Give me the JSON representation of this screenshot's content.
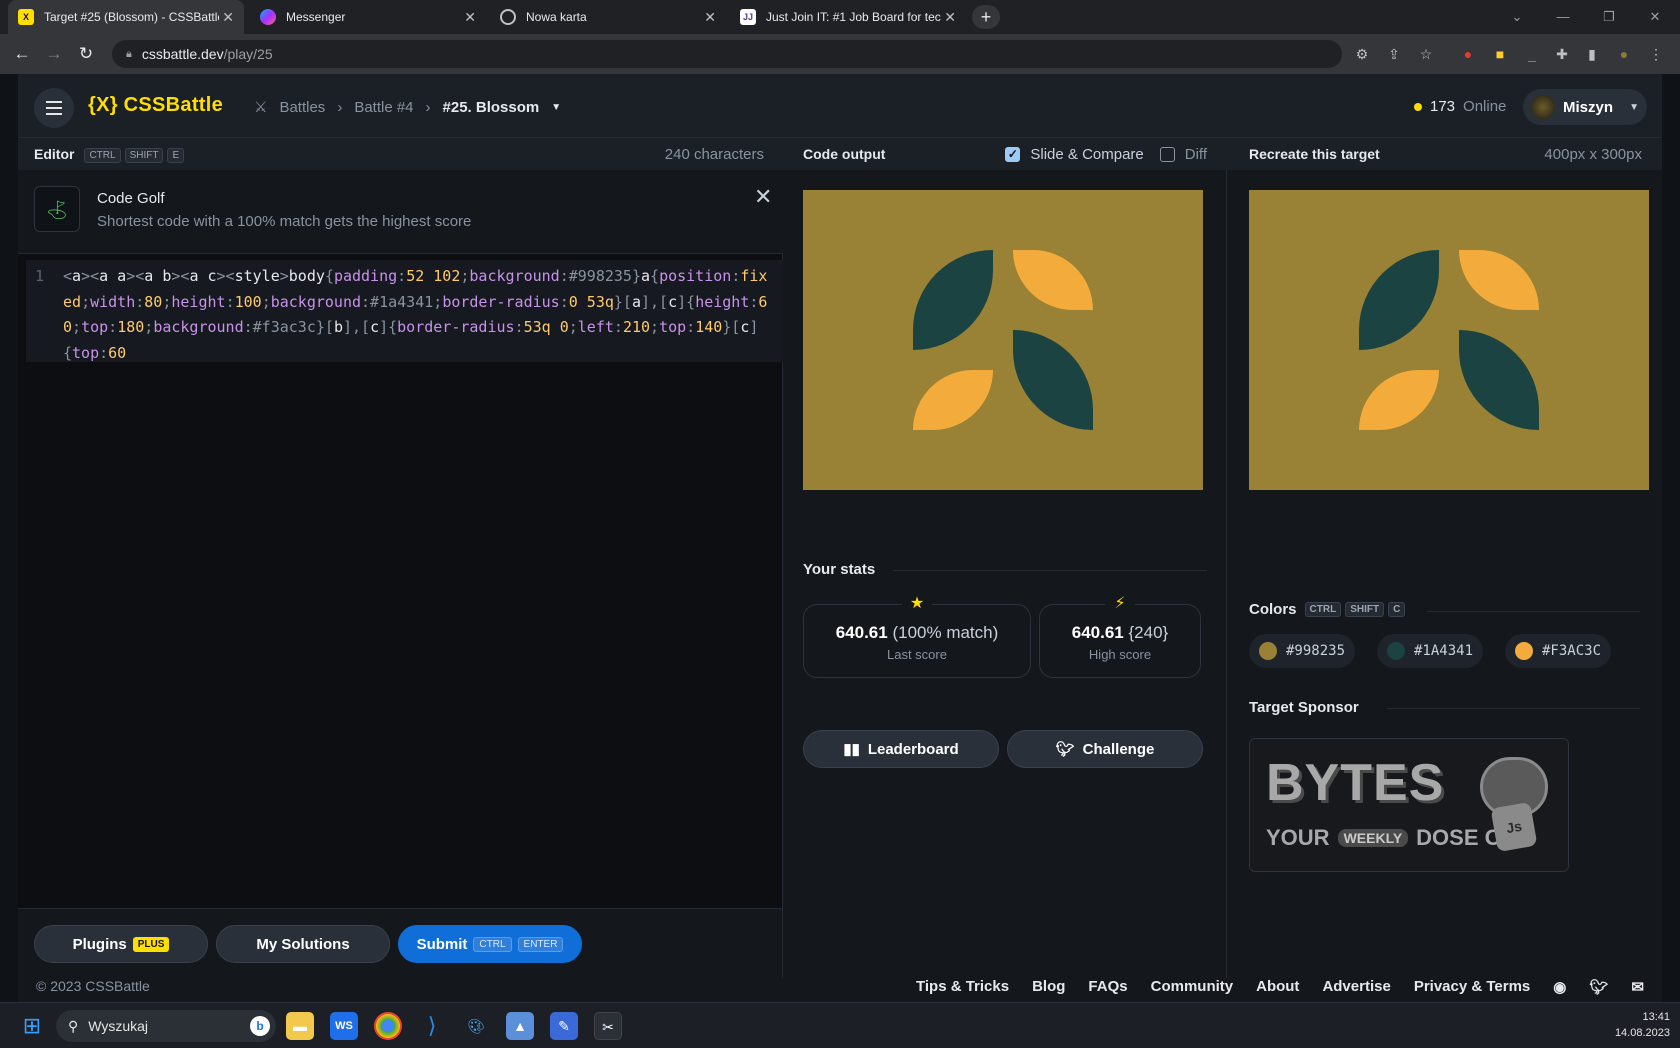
{
  "browser": {
    "tabs": [
      {
        "title": "Target #25 (Blossom) - CSSBattle",
        "icon": "cssbattle-favicon",
        "active": true
      },
      {
        "title": "Messenger",
        "icon": "messenger-favicon",
        "active": false
      },
      {
        "title": "Nowa karta",
        "icon": "chrome-favicon",
        "active": false
      },
      {
        "title": "Just Join IT: #1 Job Board for tec",
        "icon": "justjoinit-favicon",
        "active": false
      }
    ],
    "url_host": "cssbattle.dev",
    "url_path": "/play/25"
  },
  "header": {
    "logo": "{X} CSSBattle",
    "breadcrumbs": [
      "Battles",
      "Battle #4",
      "#25. Blossom"
    ],
    "online_count": "173",
    "online_label": "Online",
    "user": "Miszyn"
  },
  "editor": {
    "title": "Editor",
    "shortcut": [
      "CTRL",
      "SHIFT",
      "E"
    ],
    "chars": "240 characters",
    "golf_title": "Code Golf",
    "golf_desc": "Shortest code with a 100% match gets the highest score",
    "line_number": "1"
  },
  "footer_buttons": {
    "plugins": "Plugins",
    "plugins_tag": "PLUS",
    "solutions": "My Solutions",
    "submit": "Submit",
    "submit_keys": [
      "CTRL",
      "ENTER"
    ]
  },
  "output": {
    "title": "Code output",
    "slide_compare": "Slide & Compare",
    "diff": "Diff",
    "stats_title": "Your stats",
    "last_score": "640.61",
    "last_match": "(100% match)",
    "last_label": "Last score",
    "high_score": "640.61",
    "high_chars": "{240}",
    "high_label": "High score",
    "leaderboard": "Leaderboard",
    "challenge": "Challenge"
  },
  "target": {
    "title": "Recreate this target",
    "size": "400px x 300px",
    "colors_title": "Colors",
    "colors_keys": [
      "CTRL",
      "SHIFT",
      "C"
    ],
    "colors": [
      {
        "hex": "#998235",
        "label": "#998235"
      },
      {
        "hex": "#1A4341",
        "label": "#1A4341"
      },
      {
        "hex": "#F3AC3C",
        "label": "#F3AC3C"
      }
    ],
    "sponsor_title": "Target Sponsor",
    "sponsor_line1": "BYTES",
    "sponsor_line2": "YOUR",
    "sponsor_line3": "WEEKLY",
    "sponsor_line4": "DOSE OF"
  },
  "site_footer": {
    "copyright": "© 2023 CSSBattle",
    "links": [
      "Tips & Tricks",
      "Blog",
      "FAQs",
      "Community",
      "About",
      "Advertise",
      "Privacy & Terms"
    ]
  },
  "taskbar": {
    "search": "Wyszukaj",
    "time": "13:41",
    "date": "14.08.2023"
  }
}
